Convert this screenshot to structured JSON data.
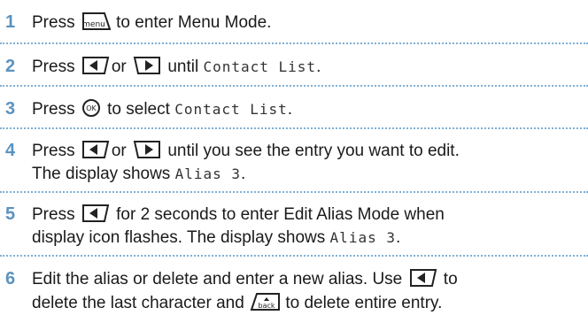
{
  "steps": [
    {
      "number": "1",
      "parts": [
        {
          "t": "text",
          "v": "Press "
        },
        {
          "t": "key",
          "v": "menu-key",
          "label": "menu"
        },
        {
          "t": "text",
          "v": " to enter Menu Mode."
        }
      ]
    },
    {
      "number": "2",
      "parts": [
        {
          "t": "text",
          "v": "Press "
        },
        {
          "t": "key",
          "v": "left-arrow-key"
        },
        {
          "t": "text",
          "v": "or "
        },
        {
          "t": "key",
          "v": "right-arrow-key"
        },
        {
          "t": "text",
          "v": " until "
        },
        {
          "t": "mono",
          "v": "Contact List"
        },
        {
          "t": "text",
          "v": "."
        }
      ]
    },
    {
      "number": "3",
      "parts": [
        {
          "t": "text",
          "v": "Press "
        },
        {
          "t": "key",
          "v": "ok-key",
          "label": "OK"
        },
        {
          "t": "text",
          "v": " to select "
        },
        {
          "t": "mono",
          "v": "Contact List"
        },
        {
          "t": "text",
          "v": "."
        }
      ]
    },
    {
      "number": "4",
      "parts": [
        {
          "t": "text",
          "v": "Press "
        },
        {
          "t": "key",
          "v": "left-arrow-key"
        },
        {
          "t": "text",
          "v": "or "
        },
        {
          "t": "key",
          "v": "right-arrow-key"
        },
        {
          "t": "text",
          "v": " until you see the entry you want to edit."
        },
        {
          "t": "br"
        },
        {
          "t": "text",
          "v": "The display shows "
        },
        {
          "t": "mono",
          "v": "Alias 3"
        },
        {
          "t": "text",
          "v": "."
        }
      ]
    },
    {
      "number": "5",
      "parts": [
        {
          "t": "text",
          "v": "Press "
        },
        {
          "t": "key",
          "v": "left-arrow-key"
        },
        {
          "t": "text",
          "v": " for 2 seconds to enter Edit Alias Mode when"
        },
        {
          "t": "br"
        },
        {
          "t": "text",
          "v": "display icon flashes. The display shows "
        },
        {
          "t": "mono",
          "v": "Alias 3"
        },
        {
          "t": "text",
          "v": "."
        }
      ]
    },
    {
      "number": "6",
      "parts": [
        {
          "t": "text",
          "v": "Edit the alias or delete and enter a new alias. Use "
        },
        {
          "t": "key",
          "v": "left-arrow-key"
        },
        {
          "t": "text",
          "v": " to"
        },
        {
          "t": "br"
        },
        {
          "t": "text",
          "v": "delete the last character and "
        },
        {
          "t": "key",
          "v": "back-key",
          "label": "back"
        },
        {
          "t": "text",
          "v": " to delete entire entry."
        }
      ]
    }
  ]
}
